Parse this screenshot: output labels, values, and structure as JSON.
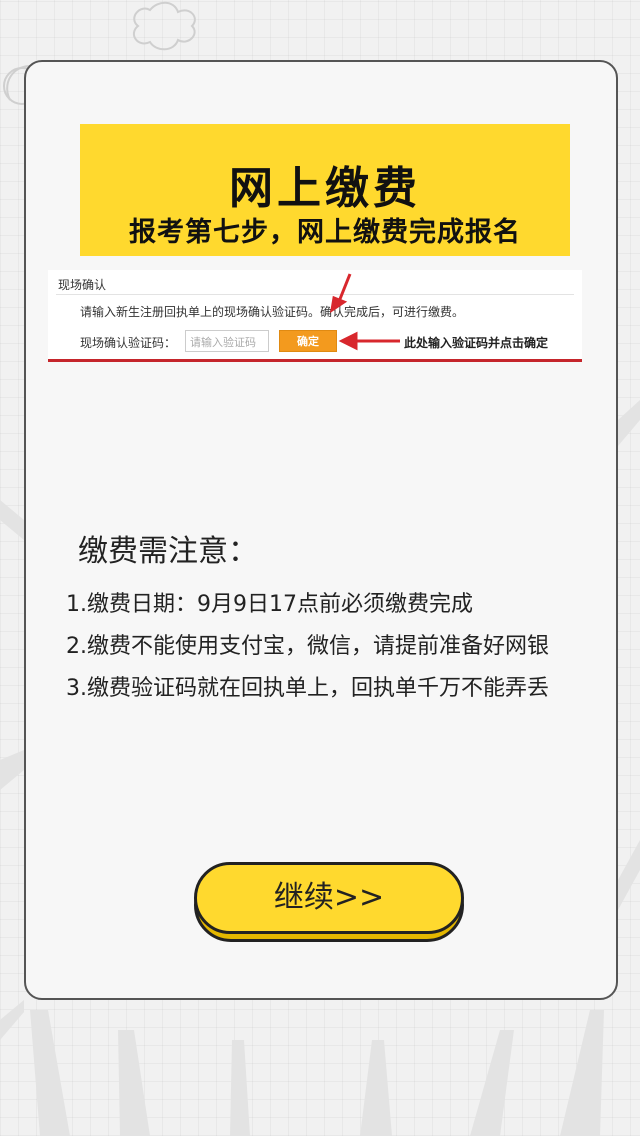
{
  "banner": {
    "title": "网上缴费",
    "subtitle": "报考第七步，网上缴费完成报名"
  },
  "screenshot": {
    "section_title": "现场确认",
    "instruction": "请输入新生注册回执单上的现场确认验证码。确认完成后，可进行缴费。",
    "field_label": "现场确认验证码：",
    "input_placeholder": "请输入验证码",
    "confirm_label": "确定",
    "annotation": "此处输入验证码并点击确定"
  },
  "notice": {
    "title": "缴费需注意：",
    "items": [
      "1.缴费日期：9月9日17点前必须缴费完成",
      "2.缴费不能使用支付宝，微信，请提前准备好网银",
      "3.缴费验证码就在回执单上，回执单千万不能弄丢"
    ]
  },
  "continue_button": {
    "label": "继续>>"
  },
  "colors": {
    "accent_yellow": "#ffd92e",
    "confirm_orange": "#f39a1e",
    "annotation_red": "#d8272d"
  }
}
